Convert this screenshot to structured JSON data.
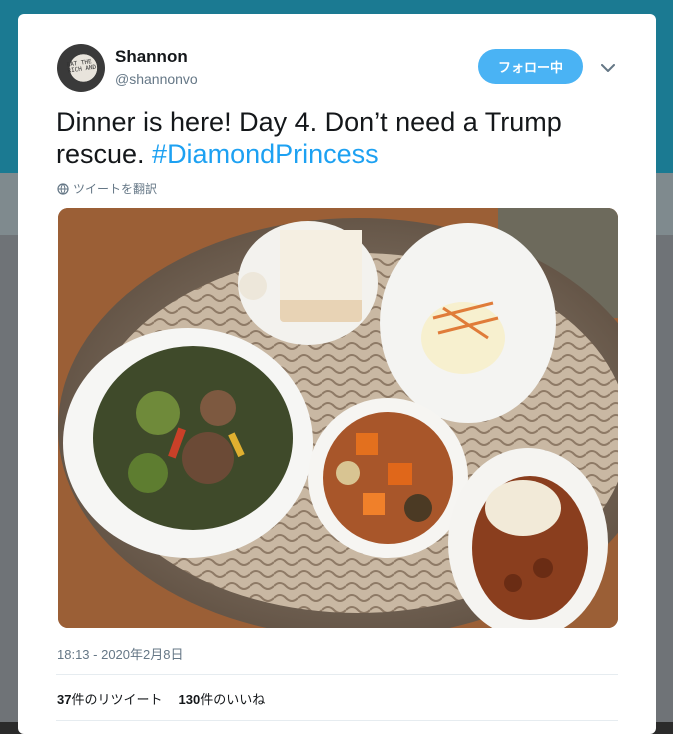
{
  "user": {
    "display_name": "Shannon",
    "handle": "@shannonvo",
    "avatar_text": "EAT THE RICH AND"
  },
  "follow_button": {
    "label": "フォロー中"
  },
  "tweet": {
    "text_part1": "Dinner is here! Day 4. Don’t need a Trump rescue. ",
    "hashtag": "#DiamondPrincess",
    "translate_label": "ツイートを翻訳",
    "timestamp": "18:13 - 2020年2月8日"
  },
  "stats": {
    "retweets_count": "37",
    "retweets_label": "件のリツイート",
    "likes_count": "130",
    "likes_label": "件のいいね"
  },
  "icons": {
    "caret": "chevron-down-icon",
    "translate": "globe-icon"
  },
  "colors": {
    "accent": "#1da1f2",
    "follow_button": "#4ab3f4",
    "secondary_text": "#657786"
  }
}
